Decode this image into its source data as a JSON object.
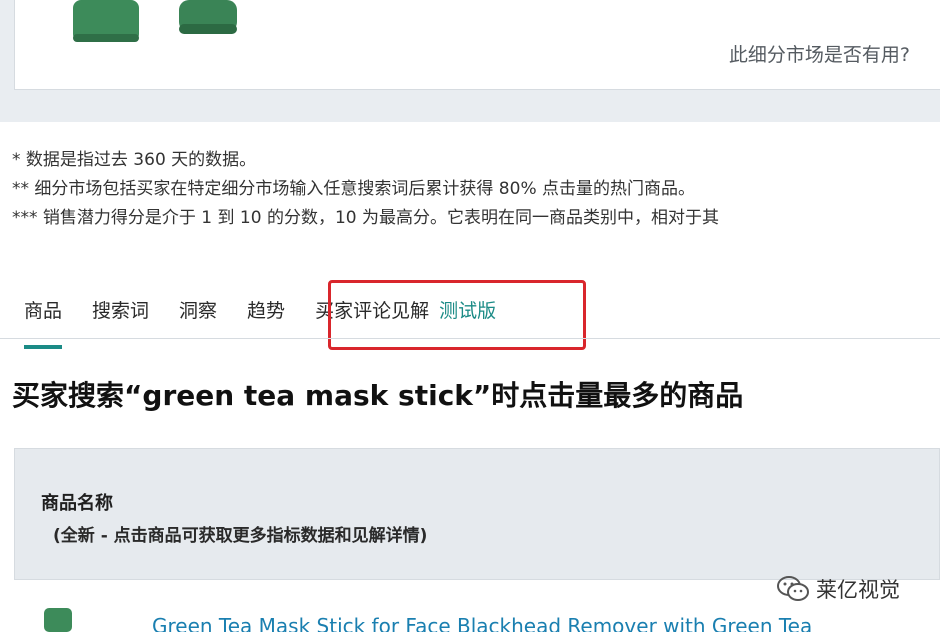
{
  "top": {
    "helpful_question": "此细分市场是否有用?"
  },
  "notes": [
    "* 数据是指过去 360 天的数据。",
    "** 细分市场包括买家在特定细分市场输入任意搜索词后累计获得 80% 点击量的热门商品。",
    "*** 销售潜力得分是介于 1 到 10 的分数，10 为最高分。它表明在同一商品类别中，相对于其"
  ],
  "tabs": [
    {
      "label": "商品",
      "active": true
    },
    {
      "label": "搜索词",
      "active": false
    },
    {
      "label": "洞察",
      "active": false
    },
    {
      "label": "趋势",
      "active": false
    },
    {
      "label": "买家评论见解",
      "badge": "测试版",
      "active": false
    }
  ],
  "heading": "买家搜索“green tea mask stick”时点击量最多的商品",
  "table": {
    "column_title": "商品名称",
    "column_subtitle": "(全新 - 点击商品可获取更多指标数据和见解详情)",
    "rows": [
      {
        "title": "Green Tea Mask Stick for Face Blackhead Remover with Green Tea"
      }
    ]
  },
  "watermark": {
    "text": "莱亿视觉",
    "icon": "wechat-icon"
  },
  "colors": {
    "accent": "#1b8b86",
    "highlight": "#d9262c",
    "link": "#1a7fb0"
  }
}
